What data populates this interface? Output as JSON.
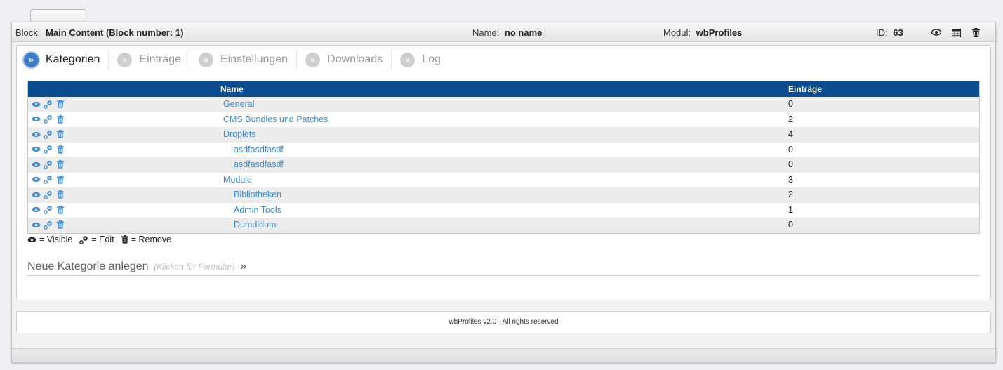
{
  "block_header": {
    "block_label": "Block:",
    "block_value": "Main Content (Block number: 1)",
    "name_label": "Name:",
    "name_value": "no name",
    "modul_label": "Modul:",
    "modul_value": "wbProfiles",
    "id_label": "ID:",
    "id_value": "63",
    "icons": [
      "eye-icon",
      "calendar-icon",
      "trash-icon"
    ]
  },
  "tabs": [
    {
      "label": "Kategorien",
      "active": true
    },
    {
      "label": "Einträge",
      "active": false
    },
    {
      "label": "Einstellungen",
      "active": false
    },
    {
      "label": "Downloads",
      "active": false
    },
    {
      "label": "Log",
      "active": false
    }
  ],
  "table": {
    "col_name": "Name",
    "col_count": "Einträge",
    "rows": [
      {
        "name": "General",
        "count": "0",
        "level": 0
      },
      {
        "name": "CMS Bundles und Patches",
        "count": "2",
        "level": 0
      },
      {
        "name": "Droplets",
        "count": "4",
        "level": 0
      },
      {
        "name": "asdfasdfasdf",
        "count": "0",
        "level": 1
      },
      {
        "name": "asdfasdfasdf",
        "count": "0",
        "level": 1
      },
      {
        "name": "Module",
        "count": "3",
        "level": 0
      },
      {
        "name": "Bibliotheken",
        "count": "2",
        "level": 1
      },
      {
        "name": "Admin Tools",
        "count": "1",
        "level": 1
      },
      {
        "name": "Dumdidum",
        "count": "0",
        "level": 1
      }
    ]
  },
  "legend": {
    "visible": "= Visible",
    "edit": "= Edit",
    "remove": "= Remove"
  },
  "new_category": {
    "label": "Neue Kategorie anlegen",
    "hint": "(Klicken für Formular)",
    "arrow": "»"
  },
  "footer": {
    "text": "wbProfiles v2.0 - All rights reserved"
  },
  "colors": {
    "header_bar": "#0b4c8f",
    "link": "#3d8bd0",
    "active_tab": "#3e7bc4"
  }
}
